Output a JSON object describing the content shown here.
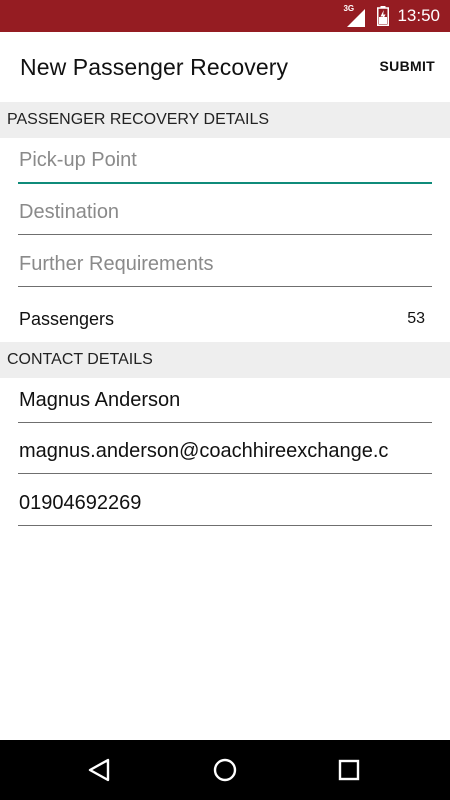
{
  "status_bar": {
    "network": "3G",
    "time": "13:50"
  },
  "header": {
    "title": "New Passenger Recovery",
    "submit_label": "SUBMIT"
  },
  "recovery_section": {
    "title": "PASSENGER RECOVERY DETAILS",
    "pickup_placeholder": "Pick-up Point",
    "destination_placeholder": "Destination",
    "requirements_placeholder": "Further Requirements",
    "passengers_label": "Passengers",
    "passengers_count": "53"
  },
  "contact_section": {
    "title": "CONTACT DETAILS",
    "name": "Magnus Anderson",
    "email": "magnus.anderson@coachhireexchange.c",
    "phone": "01904692269"
  },
  "nav_bar": {
    "back": "back-icon",
    "home": "home-icon",
    "recents": "recents-icon"
  },
  "colors": {
    "status_bar": "#951c22",
    "accent": "#0f8b7a",
    "section_bg": "#eeeeee"
  }
}
